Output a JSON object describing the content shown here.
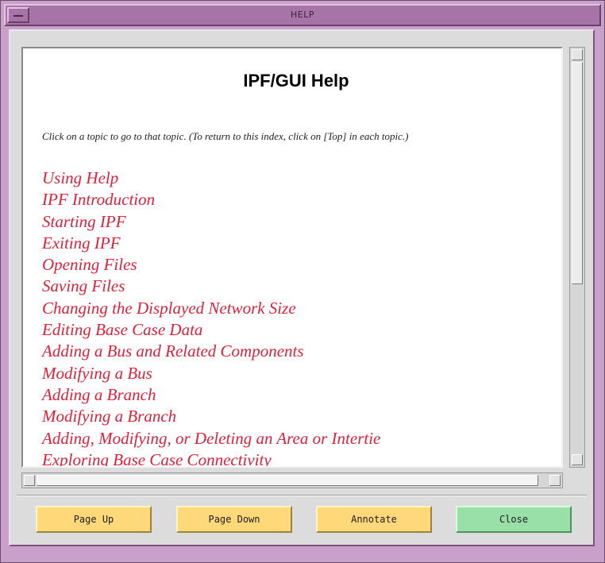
{
  "window": {
    "title": "HELP"
  },
  "document": {
    "heading": "IPF/GUI Help",
    "instructions": "Click on a topic to go to that topic. (To return to this index, click on [Top] in each topic.)",
    "topics": [
      "Using Help",
      "IPF Introduction",
      "Starting IPF",
      "Exiting IPF",
      "Opening Files",
      "Saving Files",
      "Changing the Displayed Network Size",
      "Editing Base Case Data",
      "Adding a Bus and Related Components",
      "Modifying a Bus",
      "Adding a Branch",
      "Modifying a Branch",
      "Adding, Modifying, or Deleting an Area or Intertie",
      "Exploring Base Case Connectivity"
    ],
    "link_color": "#e0203a"
  },
  "buttons": {
    "page_up": "Page Up",
    "page_down": "Page Down",
    "annotate": "Annotate",
    "close": "Close"
  },
  "colors": {
    "window_frame": "#c9a0c9",
    "title_bar": "#a774a7",
    "action_button": "#ffd87a",
    "close_button": "#98e0a8"
  },
  "icons": {
    "window_menu": "window-menu-icon",
    "scroll_up": "arrow-up-icon",
    "scroll_down": "arrow-down-icon",
    "scroll_left": "arrow-left-icon",
    "scroll_right": "arrow-right-icon"
  }
}
